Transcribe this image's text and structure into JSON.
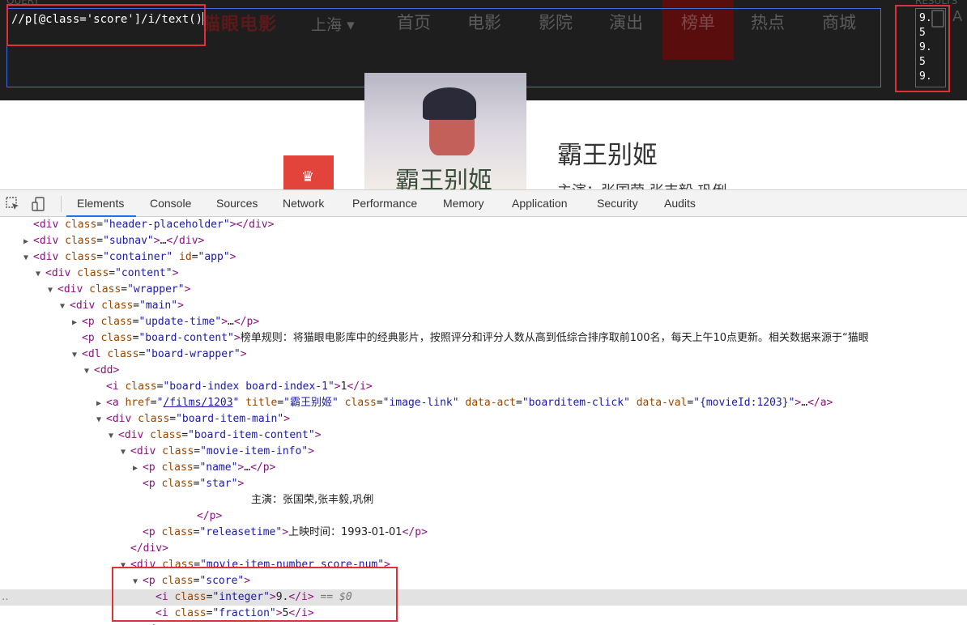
{
  "header": {
    "logo_text": "猫眼电影",
    "city": "上海",
    "city_caret": "▾",
    "nav": [
      "首页",
      "电影",
      "影院",
      "演出",
      "榜单",
      "热点",
      "商城"
    ],
    "active_nav": "榜单",
    "partial_letter": "A"
  },
  "xpath_helper": {
    "query_label": "QUERY",
    "results_label": "RESULTS",
    "query": "//p[@class='score']/i/text()",
    "results": [
      "9.",
      "5",
      "9.",
      "5",
      "9."
    ]
  },
  "movie": {
    "poster_text": "霸王别姬",
    "title": "霸王别姬",
    "star_partial": "主演：张国荣,张丰毅,巩俐"
  },
  "devtools": {
    "tabs": [
      "Elements",
      "Console",
      "Sources",
      "Network",
      "Performance",
      "Memory",
      "Application",
      "Security",
      "Audits"
    ],
    "active_tab": "Elements",
    "board_rule_text": "榜单规则：将猫眼电影库中的经典影片，按照评分和评分人数从高到低综合排序取前100名，每天上午10点更新。相关数据来源于“猫眼",
    "film_href": "/films/1203",
    "film_title": "霸王别姬",
    "star_text": "主演：张国荣,张丰毅,巩俐",
    "release_text": "上映时间：1993-01-01",
    "score_integer": "9.",
    "score_fraction": "5",
    "selected_note": "== $0",
    "colors": {
      "tag": "#881280",
      "attr_name": "#994500",
      "attr_value": "#1a1aa6",
      "highlight_box": "#e0303a",
      "query_border": "#3a6fd8",
      "active_tab_underline": "#1a73e8"
    }
  }
}
